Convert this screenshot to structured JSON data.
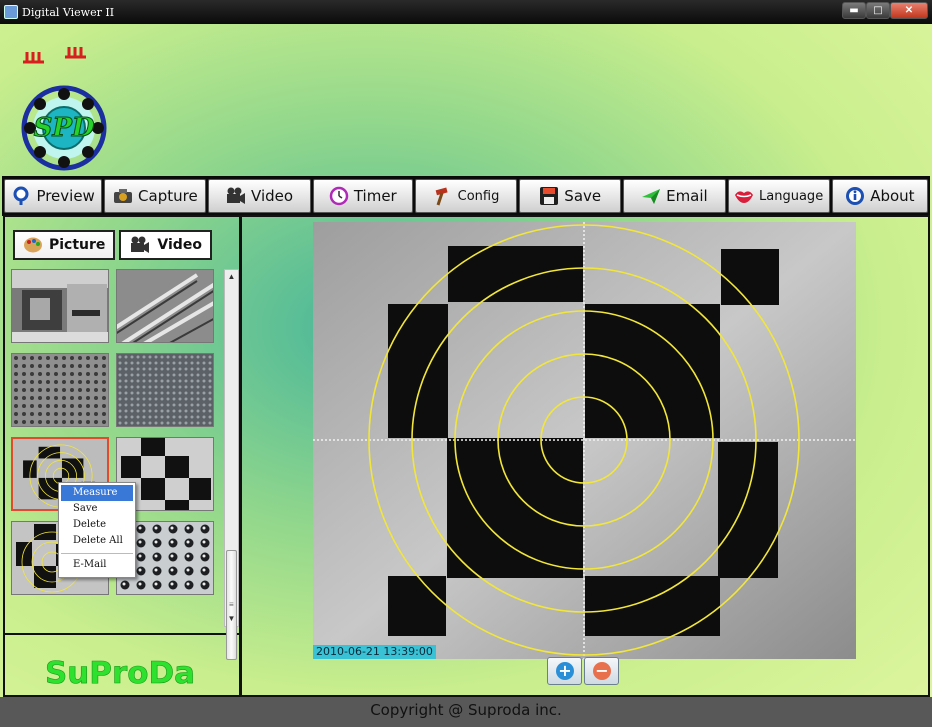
{
  "window": {
    "title": "Digital Viewer II",
    "controls": {
      "minimize": "▬",
      "maximize": "□",
      "close": "✕"
    }
  },
  "header": {
    "logo_text": "SPD",
    "logo_icon": "ring-sensor-logo"
  },
  "toolbar": {
    "buttons": [
      {
        "id": "preview",
        "label": "Preview",
        "icon": "magnifier-icon"
      },
      {
        "id": "capture",
        "label": "Capture",
        "icon": "camera-icon"
      },
      {
        "id": "video",
        "label": "Video",
        "icon": "video-camera-icon"
      },
      {
        "id": "timer",
        "label": "Timer",
        "icon": "clock-icon"
      },
      {
        "id": "config",
        "label": "Config",
        "icon": "hammer-icon"
      },
      {
        "id": "save",
        "label": "Save",
        "icon": "floppy-icon"
      },
      {
        "id": "email",
        "label": "Email",
        "icon": "paper-plane-icon"
      },
      {
        "id": "language",
        "label": "Language",
        "icon": "lips-icon"
      },
      {
        "id": "about",
        "label": "About",
        "icon": "info-icon"
      }
    ]
  },
  "gallery": {
    "tabs": [
      {
        "label": "Picture",
        "active": true,
        "icon": "palette-icon"
      },
      {
        "label": "Video",
        "active": false,
        "icon": "video-camera-icon"
      }
    ],
    "thumbnails": [
      {
        "kind": "metal-part"
      },
      {
        "kind": "needles"
      },
      {
        "kind": "knurled-grey"
      },
      {
        "kind": "knurled-dark"
      },
      {
        "kind": "checker-rings",
        "selected": true
      },
      {
        "kind": "checker"
      },
      {
        "kind": "checker-rings-2"
      },
      {
        "kind": "perforated"
      }
    ],
    "context_menu": {
      "items": [
        "Measure",
        "Save",
        "Delete",
        "Delete All"
      ],
      "after_separator": [
        "E-Mail"
      ],
      "highlighted": "Measure"
    }
  },
  "brand": {
    "name": "SuProDa"
  },
  "viewer": {
    "timestamp": "2010-06-21 13:39:00",
    "overlay_color": "#f2e63a",
    "zoom_in": "+",
    "zoom_out": "−"
  },
  "statusbar": {
    "copyright": "Copyright @ Suproda inc."
  }
}
